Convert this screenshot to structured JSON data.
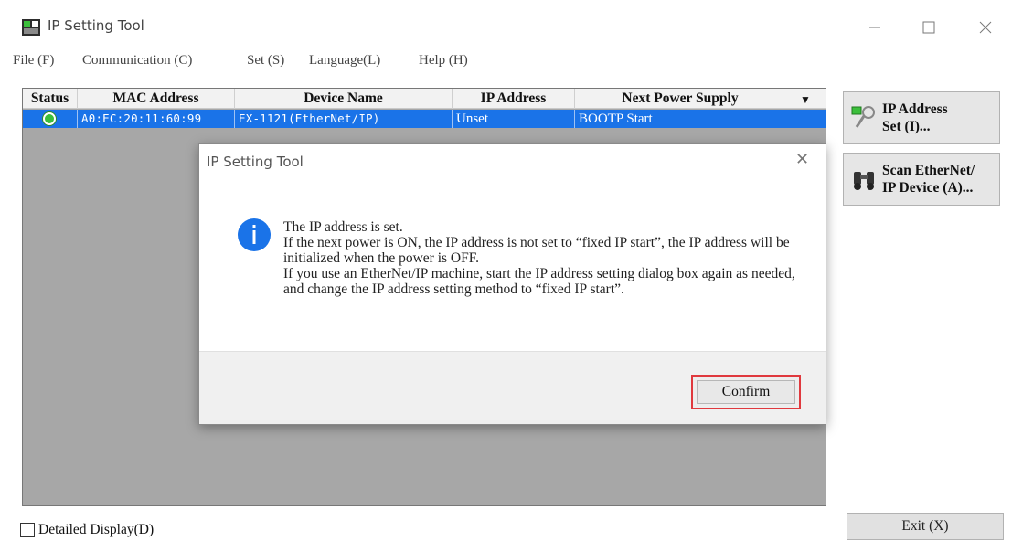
{
  "window": {
    "title": "IP Setting Tool",
    "minimize": "—",
    "maximize": "☐",
    "close": "✕"
  },
  "menu": [
    {
      "label": "File (F)"
    },
    {
      "label": "Communication (C)"
    },
    {
      "label": "Set (S)"
    },
    {
      "label": "Language(L)"
    },
    {
      "label": "Help (H)"
    }
  ],
  "table": {
    "columns": [
      "Status",
      "MAC Address",
      "Device Name",
      "IP Address",
      "Next Power Supply"
    ],
    "sort_indicator": "▼",
    "rows": [
      {
        "status": "online",
        "mac": "A0:EC:20:11:60:99",
        "device": "EX-1121(EtherNet/IP)",
        "ip": "Unset",
        "next_power": "BOOTP Start"
      }
    ]
  },
  "buttons": {
    "ip_address_set": "IP Address\nSet (I)...",
    "scan": "Scan EtherNet/\nIP Device (A)...",
    "exit": "Exit (X)"
  },
  "detailed_display": {
    "label": "Detailed Display(D)",
    "checked": false
  },
  "dialog": {
    "title": "IP Setting Tool",
    "close": "✕",
    "messages": [
      "The IP address is set.",
      "If the next power is ON, the IP address is not set to “fixed IP start”, the IP address will be initialized when the power is OFF.",
      "If you use an EtherNet/IP machine, start the IP address setting dialog box again as needed, and change the IP address setting method to “fixed IP start”."
    ],
    "confirm": "Confirm"
  },
  "colors": {
    "selection": "#1a73e8",
    "table_background": "#a7a7a7",
    "highlight_box": "#e0393e",
    "status_online": "#3bbf3b",
    "info_icon": "#1a73e8"
  }
}
